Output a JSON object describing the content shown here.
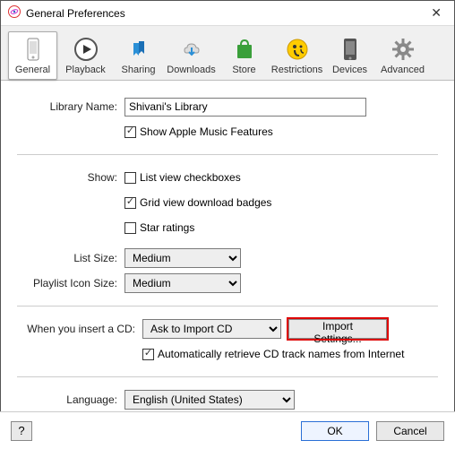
{
  "window": {
    "title": "General Preferences",
    "close": "✕"
  },
  "tabs": [
    {
      "label": "General"
    },
    {
      "label": "Playback"
    },
    {
      "label": "Sharing"
    },
    {
      "label": "Downloads"
    },
    {
      "label": "Store"
    },
    {
      "label": "Restrictions"
    },
    {
      "label": "Devices"
    },
    {
      "label": "Advanced"
    }
  ],
  "library": {
    "name_label": "Library Name:",
    "name_value": "Shivani's Library",
    "apple_music": "Show Apple Music Features"
  },
  "show": {
    "label": "Show:",
    "listview": "List view checkboxes",
    "gridbadges": "Grid view download badges",
    "star": "Star ratings"
  },
  "listsize": {
    "label": "List Size:",
    "value": "Medium"
  },
  "iconsize": {
    "label": "Playlist Icon Size:",
    "value": "Medium"
  },
  "cd": {
    "label": "When you insert a CD:",
    "value": "Ask to Import CD",
    "import_btn": "Import Settings...",
    "auto": "Automatically retrieve CD track names from Internet"
  },
  "language": {
    "label": "Language:",
    "value": "English (United States)"
  },
  "footer": {
    "help": "?",
    "ok": "OK",
    "cancel": "Cancel"
  }
}
